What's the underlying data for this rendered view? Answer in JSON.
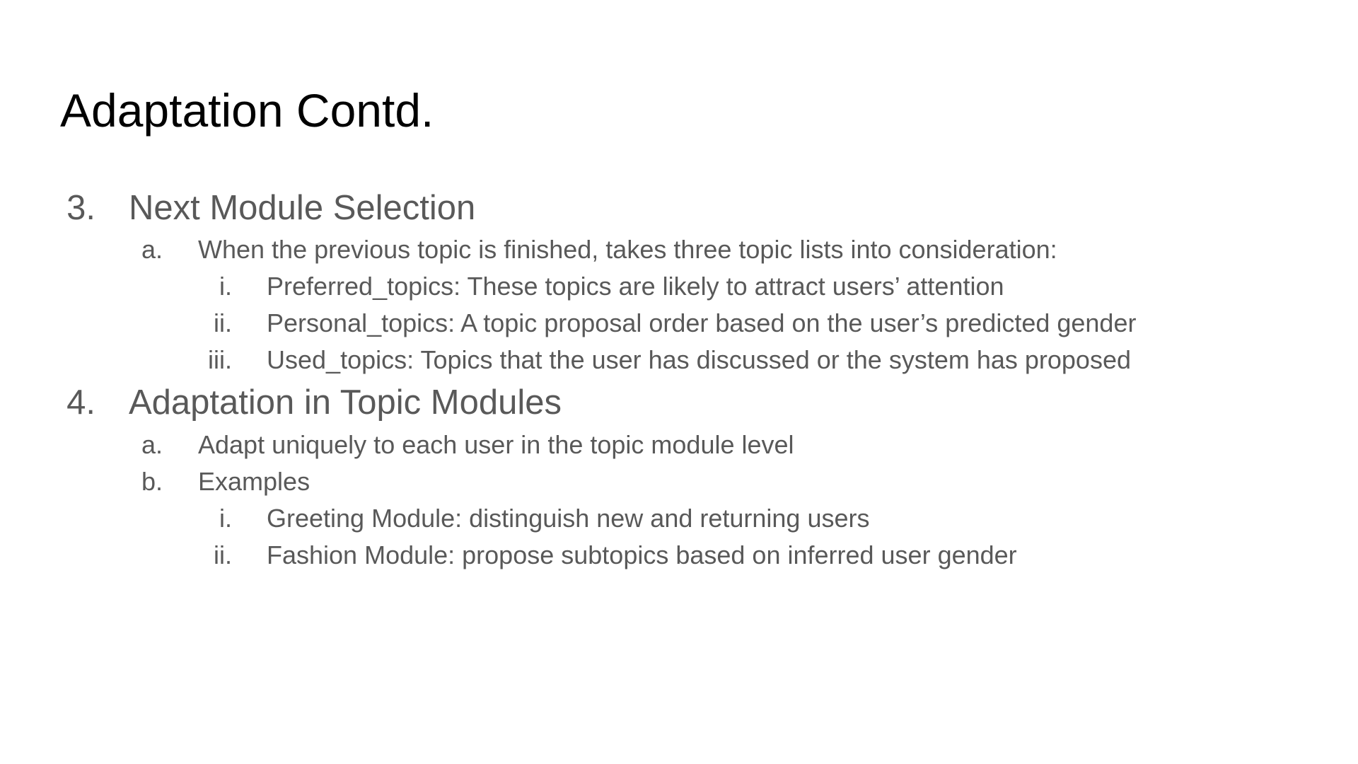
{
  "slide": {
    "title": "Adaptation Contd.",
    "items": [
      {
        "marker": "3.",
        "text": "Next Module Selection"
      },
      {
        "marker": "a.",
        "text": "When the previous topic is finished, takes three topic lists into consideration:"
      },
      {
        "marker": "i.",
        "text": "Preferred_topics: These topics are likely to attract users’ attention"
      },
      {
        "marker": "ii.",
        "text": "Personal_topics: A topic proposal order based on the user’s predicted gender"
      },
      {
        "marker": "iii.",
        "text": "Used_topics: Topics that the user has discussed or the system has proposed"
      },
      {
        "marker": "4.",
        "text": "Adaptation in Topic Modules"
      },
      {
        "marker": "a.",
        "text": "Adapt uniquely to each user in the topic module level"
      },
      {
        "marker": "b.",
        "text": "Examples"
      },
      {
        "marker": "i.",
        "text": "Greeting Module: distinguish new and returning users"
      },
      {
        "marker": "ii.",
        "text": "Fashion Module: propose subtopics based on inferred user gender"
      }
    ],
    "colors": {
      "title": "#000000",
      "body": "#595959",
      "background": "#ffffff"
    }
  }
}
